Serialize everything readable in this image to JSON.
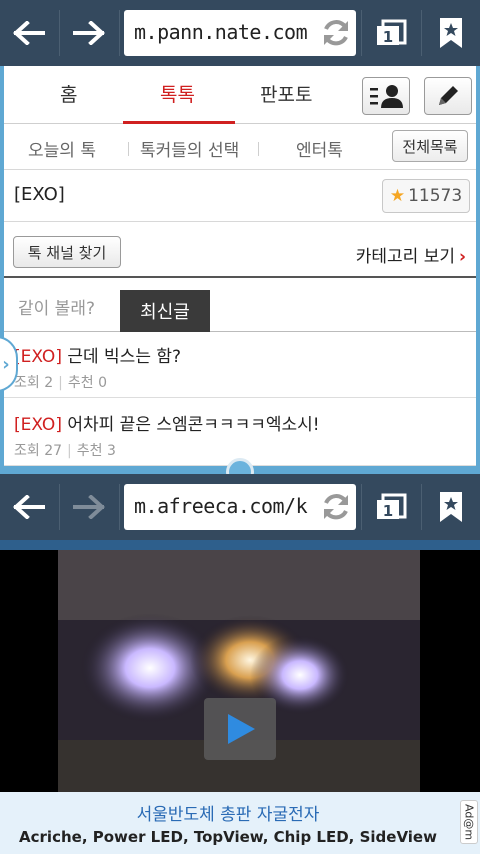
{
  "browser_top": {
    "url": "m.pann.nate.com",
    "tab_count": "1"
  },
  "page1": {
    "tabs": [
      "홈",
      "톡톡",
      "판포토"
    ],
    "active_tab_index": 1,
    "subnav": [
      "오늘의 톡",
      "톡커들의 선택",
      "엔터톡"
    ],
    "all_list_label": "전체목록",
    "channel_title": "[EXO]",
    "star_count": "11573",
    "find_channel_label": "톡 채널 찾기",
    "category_label": "카테고리 보기",
    "filter_together": "같이 볼래?",
    "filter_latest": "최신글",
    "posts": [
      {
        "tag": "[EXO]",
        "title": " 근데 빅스는 함?",
        "views_label": "조회",
        "views": "2",
        "likes_label": "추천",
        "likes": "0"
      },
      {
        "tag": "[EXO]",
        "title": " 어차피 끝은 스엠콘ㅋㅋㅋㅋ엑소시!",
        "views_label": "조회",
        "views": "27",
        "likes_label": "추천",
        "likes": "3"
      }
    ]
  },
  "browser_bottom": {
    "url": "m.afreeca.com/k",
    "tab_count": "1"
  },
  "page2": {
    "ad_title": "서울반도체 총판 자굴전자",
    "ad_subtitle": "Acriche, Power LED, TopView, Chip LED, SideView",
    "ad_brand": "Ad@m"
  },
  "colors": {
    "toolbar": "#34495e",
    "accent_red": "#d02020",
    "frame_blue": "#5fa8d3"
  }
}
